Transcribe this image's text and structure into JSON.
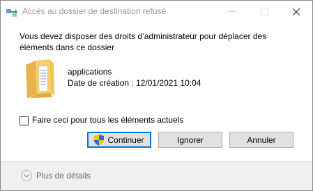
{
  "window": {
    "title": "Accès au dossier de destination refusé"
  },
  "message": "Vous devez disposer des droits d’administrateur pour déplacer des éléments dans ce dossier",
  "item": {
    "name": "applications",
    "date": "Date de création : 12/01/2021 10:04",
    "icon": "folder-icon"
  },
  "checkbox": {
    "label": "Faire ceci pour tous les éléments actuels",
    "checked": false
  },
  "buttons": {
    "continue": "Continuer",
    "ignore": "Ignorer",
    "cancel": "Annuler"
  },
  "footer": {
    "details_label": "Plus de détails"
  },
  "colors": {
    "accent": "#0078d7",
    "folder": "#f6cf6b"
  }
}
